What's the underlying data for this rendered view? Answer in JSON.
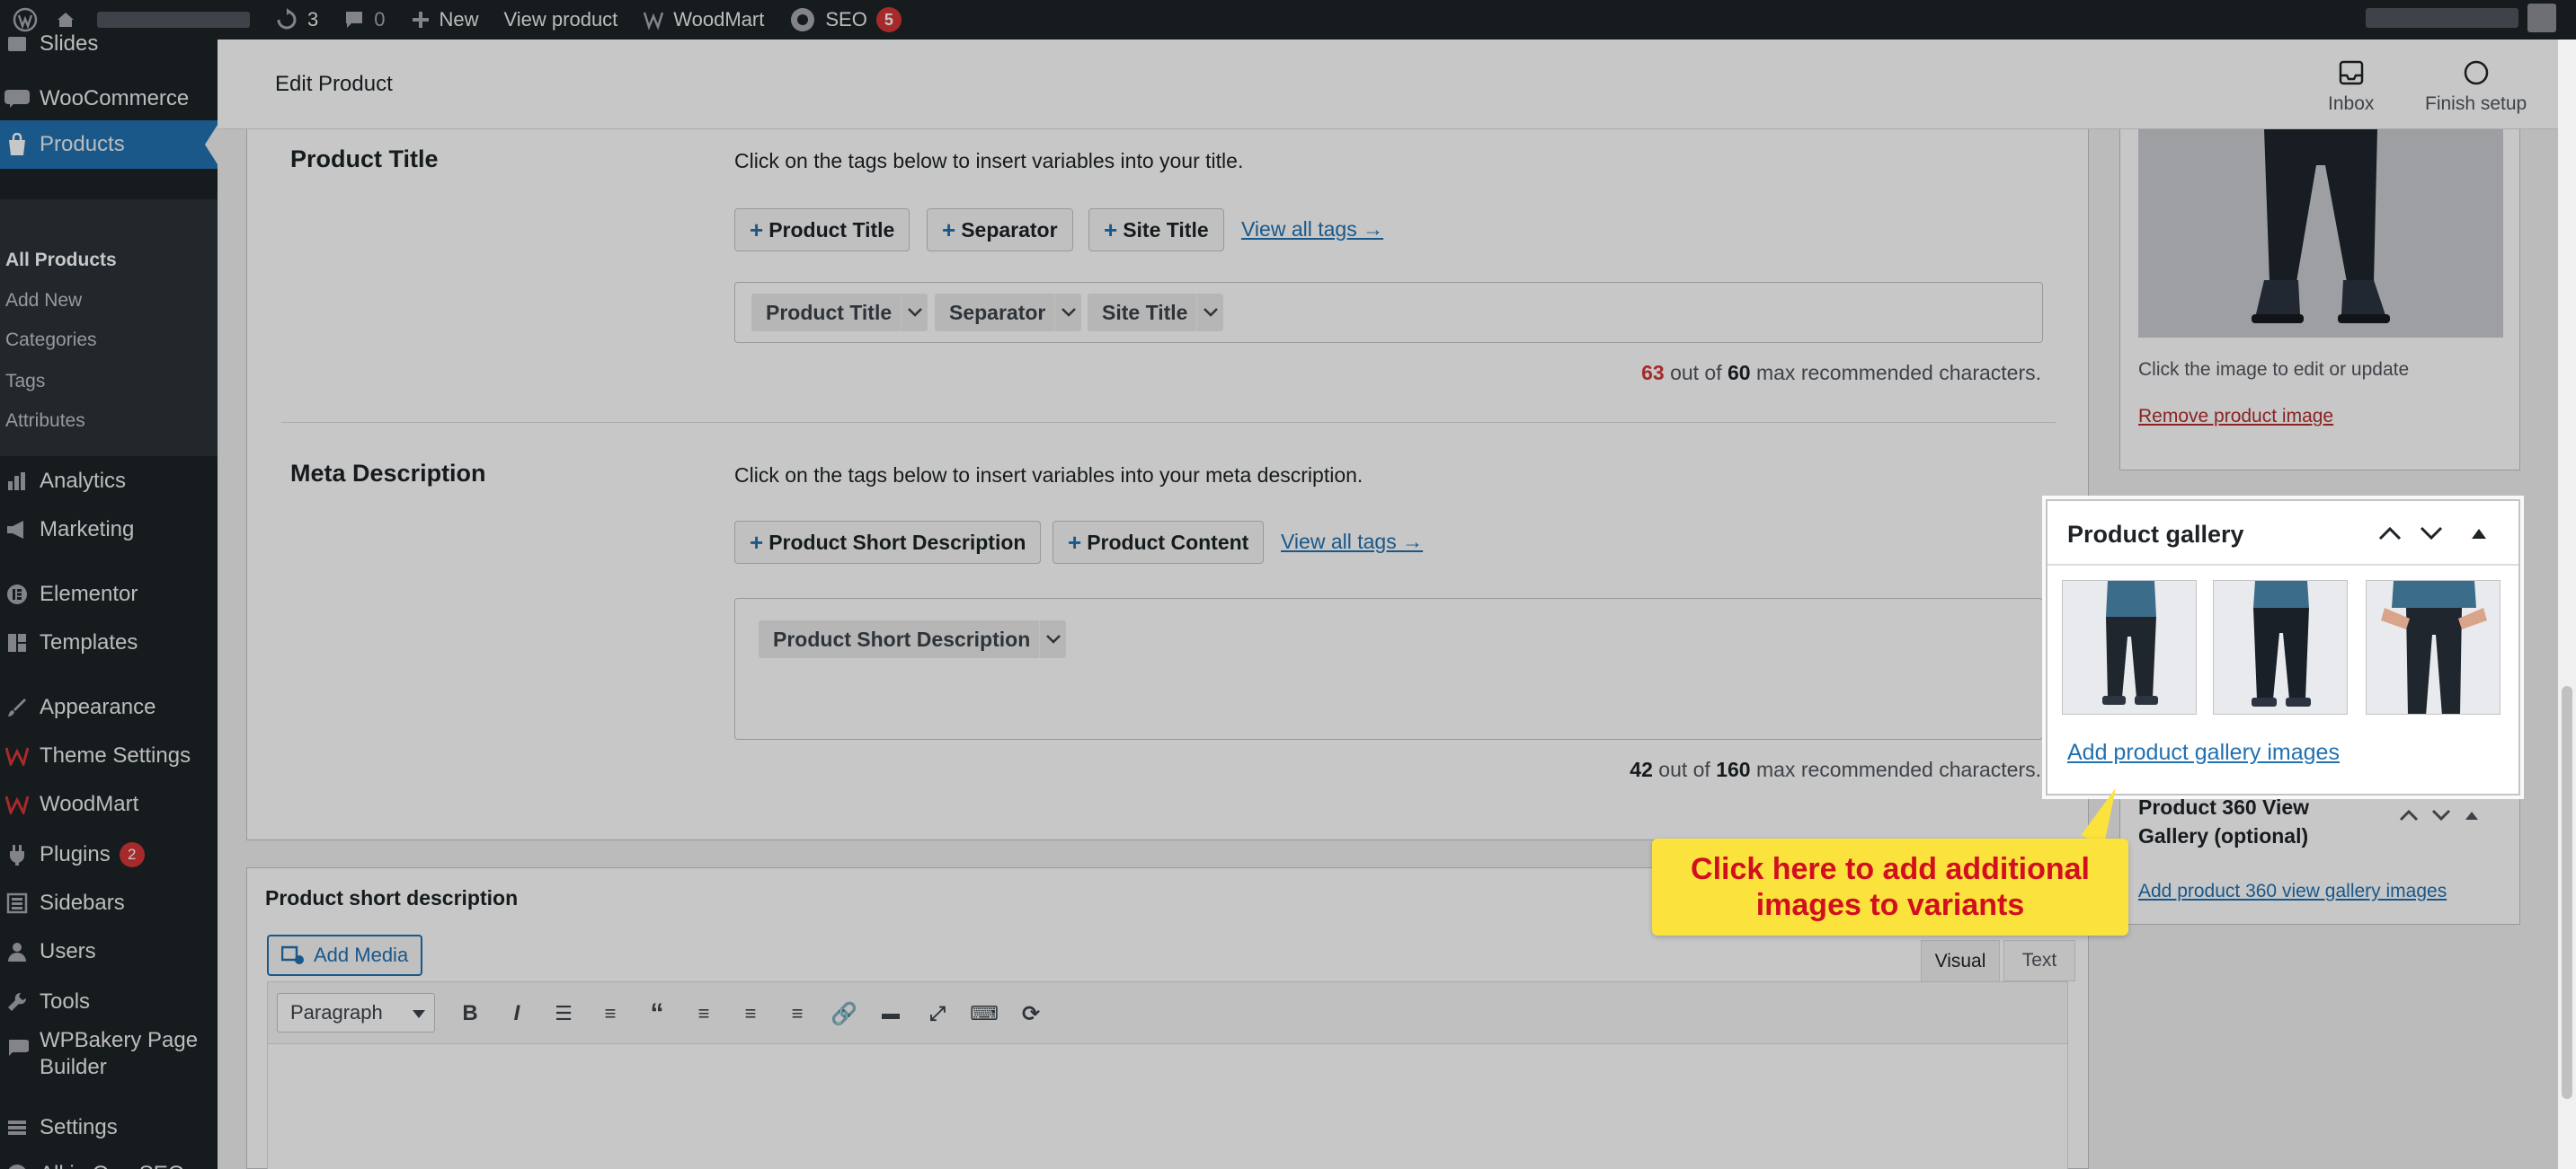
{
  "admin_bar": {
    "updates_count": "3",
    "comments_count": "0",
    "new_label": "New",
    "view_product_label": "View product",
    "woodmart_label": "WoodMart",
    "seo_label": "SEO",
    "seo_badge": "5"
  },
  "sidebar": {
    "items": [
      {
        "label": "Slides",
        "icon": "slides-icon"
      },
      {
        "label": "WooCommerce",
        "icon": "woocommerce-icon"
      },
      {
        "label": "Products",
        "icon": "products-icon"
      },
      {
        "label": "Analytics",
        "icon": "analytics-icon"
      },
      {
        "label": "Marketing",
        "icon": "marketing-icon"
      },
      {
        "label": "Elementor",
        "icon": "elementor-icon"
      },
      {
        "label": "Templates",
        "icon": "templates-icon"
      },
      {
        "label": "Appearance",
        "icon": "appearance-icon"
      },
      {
        "label": "Theme Settings",
        "icon": "theme-settings-icon"
      },
      {
        "label": "WoodMart",
        "icon": "woodmart-icon"
      },
      {
        "label": "Plugins",
        "icon": "plugins-icon",
        "badge": "2"
      },
      {
        "label": "Sidebars",
        "icon": "sidebars-icon"
      },
      {
        "label": "Users",
        "icon": "users-icon"
      },
      {
        "label": "Tools",
        "icon": "tools-icon"
      },
      {
        "label": "WPBakery Page",
        "label2": "Builder",
        "icon": "wpbakery-icon"
      },
      {
        "label": "Settings",
        "icon": "settings-icon"
      },
      {
        "label": "All in One SEO",
        "icon": "aioseo-icon"
      }
    ],
    "submenu": [
      "All Products",
      "Add New",
      "Categories",
      "Tags",
      "Attributes"
    ]
  },
  "header": {
    "title": "Edit Product",
    "inbox_label": "Inbox",
    "finish_setup_label": "Finish setup"
  },
  "seo": {
    "product_title": {
      "label": "Product Title",
      "helper": "Click on the tags below to insert variables into your title.",
      "tags": [
        "Product Title",
        "Separator",
        "Site Title"
      ],
      "view_all": "View all tags →",
      "chips": [
        "Product Title",
        "Separator",
        "Site Title"
      ],
      "count": "63",
      "max": "60",
      "suffix_mid": "out of",
      "suffix_end": "max recommended characters."
    },
    "meta_description": {
      "label": "Meta Description",
      "helper": "Click on the tags below to insert variables into your meta description.",
      "tags": [
        "Product Short Description",
        "Product Content"
      ],
      "view_all": "View all tags →",
      "chips": [
        "Product Short Description"
      ],
      "count": "42",
      "max": "160",
      "suffix_mid": "out of",
      "suffix_end": "max recommended characters."
    }
  },
  "short_description": {
    "title": "Product short description",
    "add_media": "Add Media",
    "tab_visual": "Visual",
    "tab_text": "Text",
    "format": "Paragraph"
  },
  "product_image": {
    "hint": "Click the image to edit or update",
    "remove_link": "Remove product image"
  },
  "gallery": {
    "title": "Product gallery",
    "add_link": "Add product gallery images"
  },
  "gallery_360": {
    "title_line1": "Product 360 View",
    "title_line2": "Gallery (optional)",
    "add_link": "Add product 360 view gallery images"
  },
  "callout": {
    "line1": "Click here to add additional",
    "line2": "images to variants"
  }
}
